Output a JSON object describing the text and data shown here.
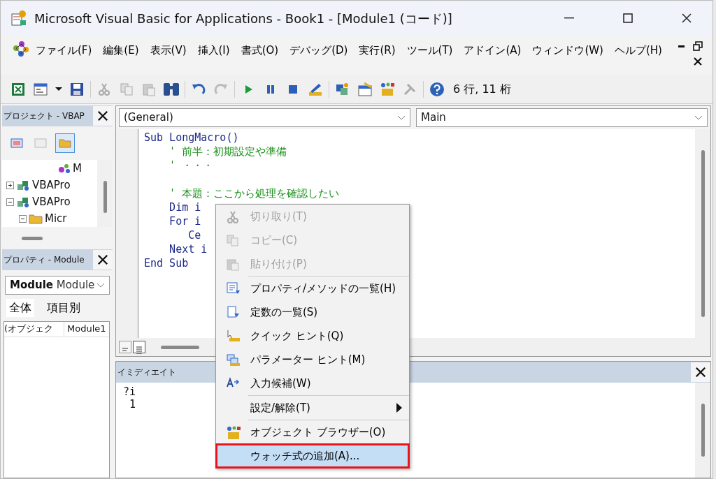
{
  "window": {
    "title": "Microsoft Visual Basic for Applications - Book1 - [Module1 (コード)]"
  },
  "menu_bar": [
    "ファイル(F)",
    "編集(E)",
    "表示(V)",
    "挿入(I)",
    "書式(O)",
    "デバッグ(D)",
    "実行(R)",
    "ツール(T)",
    "アドイン(A)",
    "ウィンドウ(W)",
    "ヘルプ(H)"
  ],
  "toolbar": {
    "position": "6 行, 11 桁"
  },
  "project_panel": {
    "title": "プロジェクト - VBAP",
    "tree": [
      {
        "label": "M",
        "kind": "module"
      },
      {
        "label": "VBAPro",
        "kind": "project",
        "expanded": false
      },
      {
        "label": "VBAPro",
        "kind": "project",
        "expanded": true,
        "children": [
          {
            "label": "Micr",
            "kind": "folder",
            "expanded": true
          }
        ]
      }
    ]
  },
  "properties_panel": {
    "title": "プロパティ - Module",
    "object_name": "Module",
    "object_type": "Module",
    "tabs": [
      {
        "label": "全体",
        "selected": true
      },
      {
        "label": "項目別",
        "selected": false
      }
    ],
    "rows": [
      {
        "name": "(オブジェク",
        "value": "Module1"
      }
    ]
  },
  "code_window": {
    "object_dropdown": "(General)",
    "procedure_dropdown": "Main",
    "lines": [
      {
        "text": "Sub LongMacro()",
        "kind": "code"
      },
      {
        "text": "    ' 前半：初期設定や準備",
        "kind": "comment"
      },
      {
        "text": "    ' ・・・",
        "kind": "comment"
      },
      {
        "kind": "blank"
      },
      {
        "text": "    ' 本題：ここから処理を確認したい",
        "kind": "comment"
      },
      {
        "text": "    Dim i",
        "kind": "code"
      },
      {
        "text": "    For i",
        "kind": "code"
      },
      {
        "text": "       Ce",
        "kind": "code"
      },
      {
        "text": "    Next i",
        "kind": "code"
      },
      {
        "text": "End Sub",
        "kind": "code"
      }
    ],
    "views": [
      {
        "kind": "procedure",
        "selected": false
      },
      {
        "kind": "module",
        "selected": true
      }
    ]
  },
  "immediate_window": {
    "title": "イミディエイト",
    "lines": [
      "?i",
      " 1"
    ]
  },
  "context_menu": [
    {
      "label": "切り取り(T)",
      "kind": "item",
      "disabled": true,
      "selected": false,
      "highlighted": false
    },
    {
      "label": "コピー(C)",
      "kind": "item",
      "disabled": true,
      "selected": false,
      "highlighted": false
    },
    {
      "label": "貼り付け(P)",
      "kind": "item",
      "disabled": true,
      "selected": false,
      "highlighted": false
    },
    {
      "kind": "separator"
    },
    {
      "label": "プロパティ/メソッドの一覧(H)",
      "kind": "item",
      "disabled": false,
      "selected": false,
      "highlighted": false
    },
    {
      "label": "定数の一覧(S)",
      "kind": "item",
      "disabled": false,
      "selected": false,
      "highlighted": false
    },
    {
      "label": "クイック ヒント(Q)",
      "kind": "item",
      "disabled": false,
      "selected": false,
      "highlighted": false
    },
    {
      "label": "パラメーター ヒント(M)",
      "kind": "item",
      "disabled": false,
      "selected": false,
      "highlighted": false
    },
    {
      "label": "入力候補(W)",
      "kind": "item",
      "disabled": false,
      "selected": false,
      "highlighted": false
    },
    {
      "kind": "separator"
    },
    {
      "label": "設定/解除(T)",
      "kind": "submenu",
      "disabled": false,
      "selected": false,
      "highlighted": false
    },
    {
      "kind": "separator"
    },
    {
      "label": "オブジェクト ブラウザー(O)",
      "kind": "item",
      "disabled": false,
      "selected": false,
      "highlighted": false
    },
    {
      "label": "ウォッチ式の追加(A)...",
      "kind": "item",
      "disabled": false,
      "selected": true,
      "highlighted": true
    }
  ]
}
